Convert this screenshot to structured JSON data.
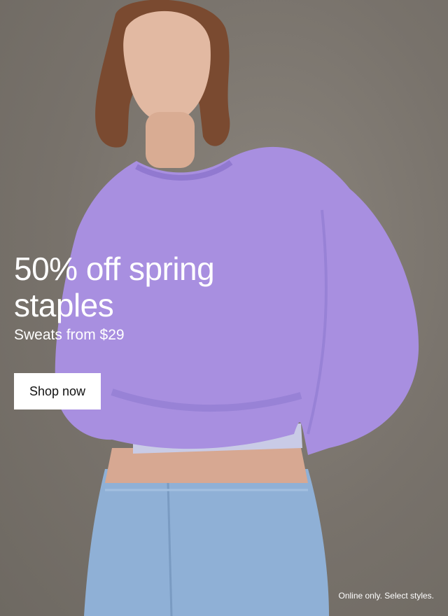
{
  "hero": {
    "headline": "50% off spring staples",
    "subhead": "Sweats from $29",
    "cta_label": "Shop now",
    "disclaimer": "Online only. Select styles."
  },
  "colors": {
    "background": "#7d7770",
    "sweatshirt": "#a88fe0",
    "denim": "#8fb0d6",
    "text": "#ffffff",
    "button": "#ffffff",
    "button_text": "#111111"
  }
}
